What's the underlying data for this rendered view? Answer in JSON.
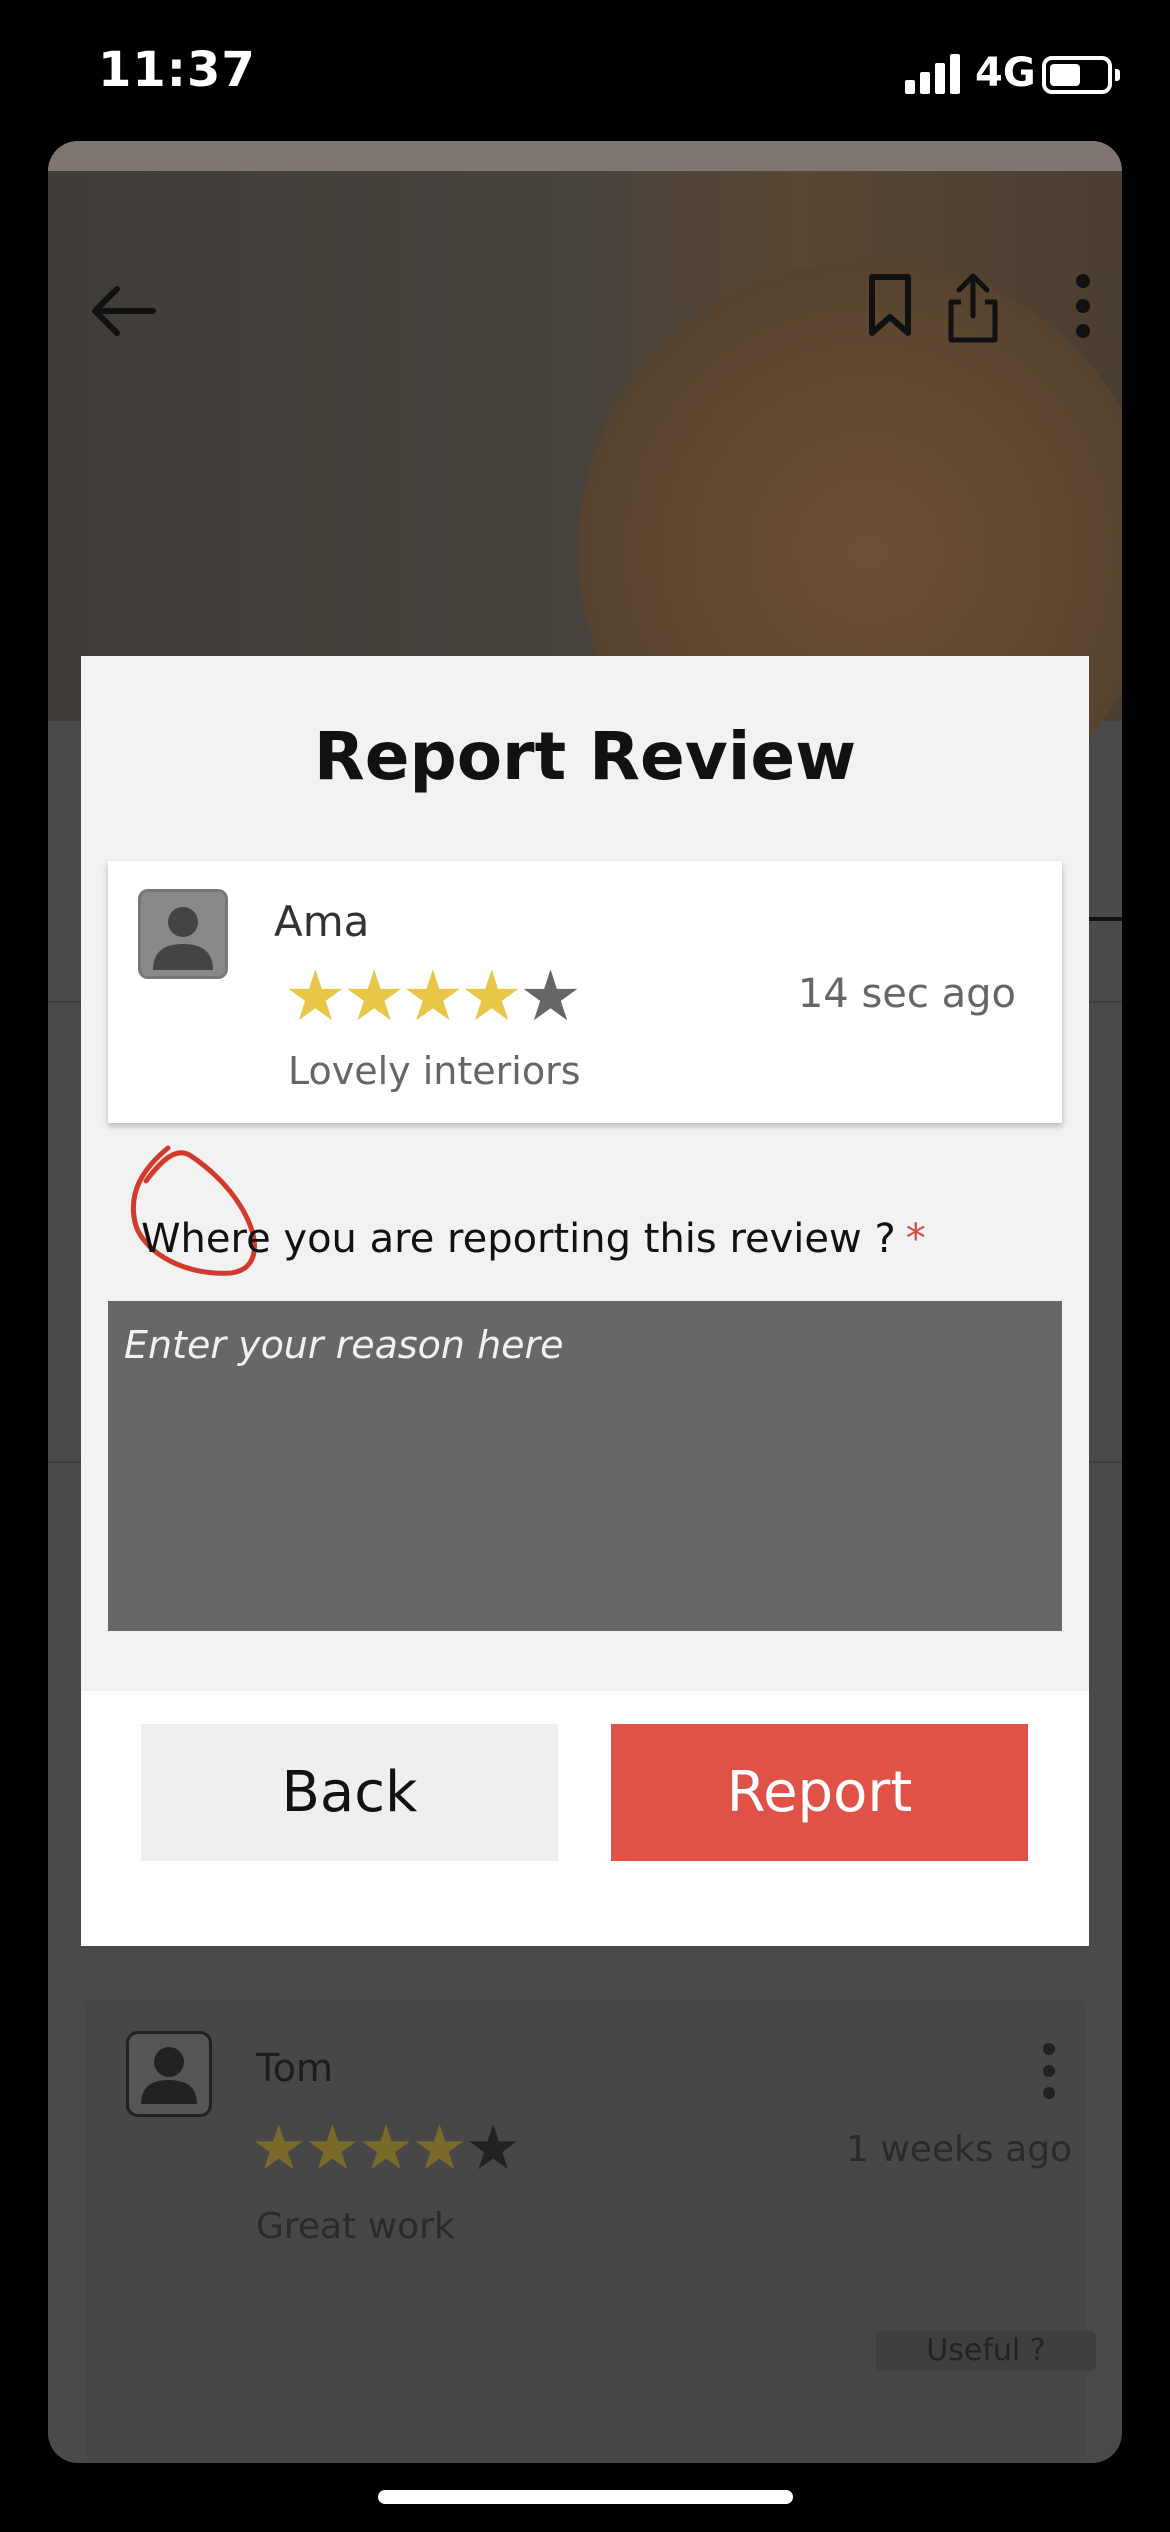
{
  "status_bar": {
    "time": "11:37",
    "network": "4G",
    "icons": [
      "signal-icon",
      "battery-icon"
    ]
  },
  "header_icons": [
    "back-arrow-icon",
    "bookmark-icon",
    "share-icon",
    "more-vertical-icon"
  ],
  "background_review": {
    "name": "Tom",
    "rating": 4,
    "max_rating": 5,
    "time": "1 weeks ago",
    "text": "Great work",
    "helpful_label": "Useful ?"
  },
  "modal": {
    "title": "Report Review",
    "review": {
      "name": "Ama",
      "rating": 4,
      "max_rating": 5,
      "time": "14 sec ago",
      "text": "Lovely interiors"
    },
    "question": "Where you are reporting this review ?",
    "required_mark": "*",
    "reason_placeholder": "Enter your reason here",
    "back_label": "Back",
    "report_label": "Report"
  },
  "colors": {
    "star_filled": "#e8c648",
    "star_empty": "#666666",
    "report_button": "#e05147",
    "required_mark": "#d94b40",
    "annotation_circle": "#d23a2e"
  }
}
